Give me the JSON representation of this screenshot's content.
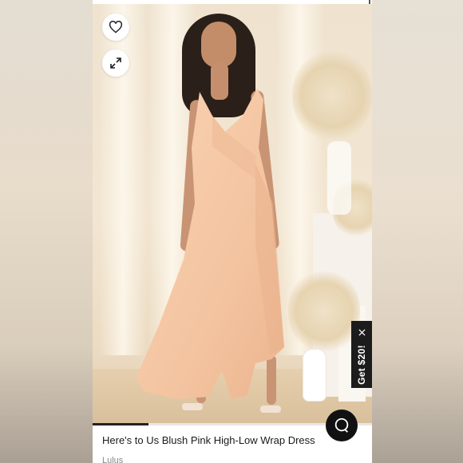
{
  "product": {
    "title": "Here's to Us Blush Pink High-Low Wrap Dress",
    "brand": "Lulus"
  },
  "actions": {
    "favorite_icon": "heart-icon",
    "expand_icon": "expand-icon"
  },
  "promo": {
    "label": "Get $20!",
    "close_icon": "close-icon"
  },
  "chat": {
    "icon": "chat-icon"
  },
  "gallery": {
    "progress": 0.2
  },
  "colors": {
    "dress": "#f6c9a8",
    "promo_bg": "#1c1c1c",
    "chat_bg": "#111111"
  }
}
